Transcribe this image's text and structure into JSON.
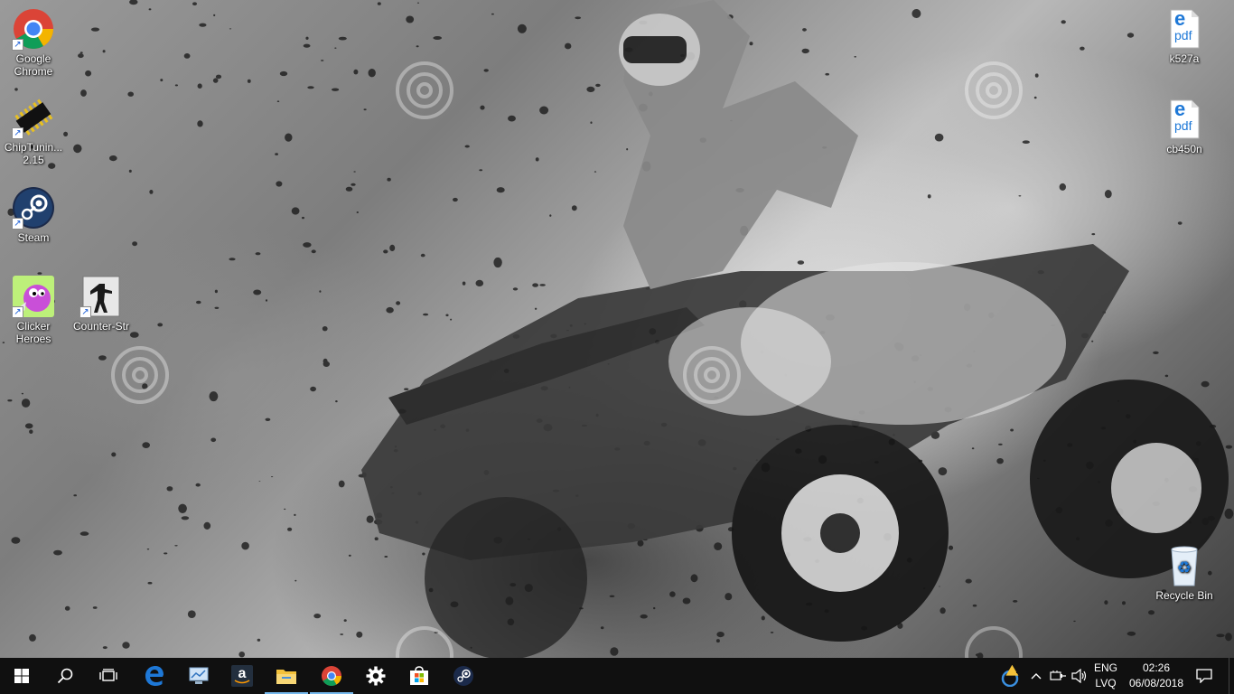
{
  "desktop": {
    "icons_left": [
      {
        "label": "Google Chrome",
        "icon": "chrome-icon"
      },
      {
        "label": "ChipTuning 2.15",
        "icon": "chip-icon"
      },
      {
        "label": "Steam",
        "icon": "steam-icon"
      },
      {
        "label": "Clicker Heroes",
        "icon": "clicker-heroes-icon"
      },
      {
        "label": "Counter-Str",
        "icon": "counter-strike-icon"
      }
    ],
    "icons_right": [
      {
        "label": "k527a",
        "icon": "edge-pdf-icon"
      },
      {
        "label": "cb450n",
        "icon": "edge-pdf-icon"
      },
      {
        "label": "Recycle Bin",
        "icon": "recycle-bin-icon"
      }
    ],
    "chip_label_display": "ChipTunin... 2.15",
    "pdf_badge": "pdf",
    "edge_letter": "e"
  },
  "taskbar": {
    "pinned": [
      {
        "name": "start",
        "icon": "windows-logo-icon"
      },
      {
        "name": "search",
        "icon": "search-icon"
      },
      {
        "name": "task-view",
        "icon": "task-view-icon"
      },
      {
        "name": "edge",
        "icon": "edge-icon"
      },
      {
        "name": "control-panel",
        "icon": "control-panel-icon"
      },
      {
        "name": "amazon",
        "icon": "amazon-icon"
      },
      {
        "name": "file-explorer",
        "icon": "folder-icon"
      },
      {
        "name": "chrome",
        "icon": "chrome-icon"
      },
      {
        "name": "settings",
        "icon": "gear-icon"
      },
      {
        "name": "store",
        "icon": "store-icon"
      },
      {
        "name": "steam",
        "icon": "steam-icon"
      }
    ],
    "amazon_letter": "a",
    "tray": {
      "language_top": "ENG",
      "language_bottom": "LVQ",
      "time": "02:26",
      "date": "06/08/2018",
      "warning_glyph": "!"
    }
  },
  "colors": {
    "taskbar_bg": "#101010",
    "active_indicator": "#76b9ed",
    "edge_blue": "#1e78d7",
    "folder_yellow": "#f3c13a"
  }
}
